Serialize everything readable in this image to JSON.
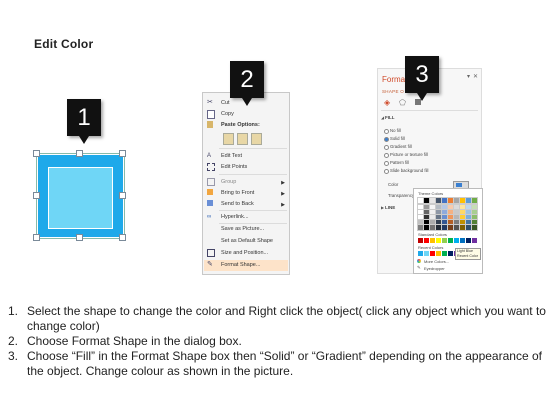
{
  "title": "Edit Color",
  "steps_badges": [
    "1",
    "2",
    "3"
  ],
  "context_menu": {
    "items": [
      {
        "label": "Cut",
        "icon": "scissors-icon"
      },
      {
        "label": "Copy",
        "icon": "copy-icon"
      },
      {
        "label": "Paste Options:",
        "icon": "paste-icon"
      },
      {
        "label": "Edit Text",
        "icon": "edit-text-icon"
      },
      {
        "label": "Edit Points",
        "icon": "edit-points-icon"
      },
      {
        "label": "Group",
        "icon": "group-icon"
      },
      {
        "label": "Bring to Front",
        "icon": "bring-front-icon"
      },
      {
        "label": "Send to Back",
        "icon": "send-back-icon"
      },
      {
        "label": "Hyperlink...",
        "icon": "hyperlink-icon"
      },
      {
        "label": "Save as Picture...",
        "icon": ""
      },
      {
        "label": "Set as Default Shape",
        "icon": ""
      },
      {
        "label": "Size and Position...",
        "icon": "size-position-icon"
      },
      {
        "label": "Format Shape...",
        "icon": "format-shape-icon"
      }
    ]
  },
  "format_pane": {
    "title": "Format",
    "subtitle": "SHAPE O      IONS",
    "fill_label": "FILL",
    "options": [
      "No fill",
      "Solid fill",
      "Gradient fill",
      "Picture or texture fill",
      "Pattern fill",
      "Slide background fill"
    ],
    "color_label": "Color",
    "transparency_label": "Transparency",
    "line_label": "LINE",
    "palette": {
      "theme_label": "Theme Colors",
      "standard_label": "Standard Colors",
      "recent_label": "Recent Colors",
      "more_label": "More Colors...",
      "eyedropper_label": "Eyedropper",
      "tooltip": "Light Blue",
      "tooltip_sub": "Recent Color"
    }
  },
  "instructions": [
    {
      "num": "1.",
      "text": "Select the shape to change the color and Right click the object( click any object which you want to change color)"
    },
    {
      "num": "2.",
      "text": "Choose Format Shape in the dialog box."
    },
    {
      "num": "3.",
      "text": "Choose “Fill” in the Format Shape box then “Solid” or “Gradient” depending on the appearance of the object. Change colour as shown in the picture."
    }
  ],
  "colors": {
    "shape_outer": "#1ea9ea",
    "shape_inner": "#6fd6f6",
    "format_title": "#d04a2a",
    "menu_highlight": "#fde3c9"
  }
}
